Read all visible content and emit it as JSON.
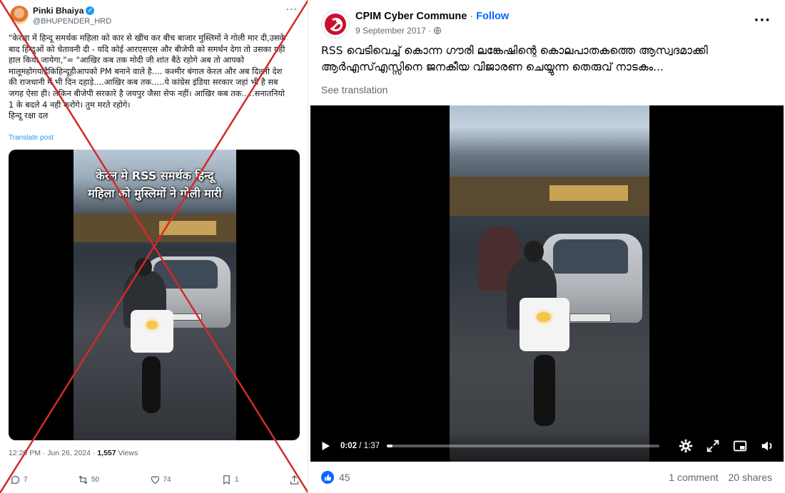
{
  "tweet": {
    "display_name": "Pinki Bhaiya",
    "handle": "@BHUPENDER_HRD",
    "text": "\"केरला में हिन्दू समर्थक महिला को कार से खींच कर बीच बाजार मुस्लिमों ने गोली मार दी,उसके बाद हिन्दुओं को चेतावनी दी - यदि कोई आरएसएस और बीजेपी को समर्थन देगा तो उसका यही हाल किया जायेगा,\"= \"आखिर कब तक मोदी जी शांत बैठे रहोगे अब तो आपको मालूमहोगयाहैकिहिन्दूहीआपको PM बनाने वाले है.... कश्मीर बंगाल केरल और अब दिल्ली देश की राजधानी में भी दिन दहाड़े....आखिर कब तक.....ये कांग्रेस इंडिया सरकार जहां भी है सब जगह ऐसा ही। लेकिन बीजेपी सरकारे है जयपुर जैसा सेफ नहीं। आखिर कब तक.....सनातनियो 1 के बदले 4 नही करोगे। तुम मरते रहोगे।\nहिन्दू रक्षा दल",
    "translate_label": "Translate post",
    "video_caption_line1": "केरल मे RSS समर्थक हिन्दू",
    "video_caption_line2": "महिला को मुस्लिमों ने गोली मारी",
    "timestamp": "12:20 PM · Jun 26, 2024 · ",
    "views_count": "1,557",
    "views_label": " Views",
    "replies": "7",
    "reposts": "50",
    "likes": "74",
    "bookmarks": "1",
    "crossed_out_color": "#d62828"
  },
  "facebook": {
    "page_name": "CPIM Cyber Commune",
    "separator": " · ",
    "follow_label": "Follow",
    "date": "9 September 2017 ·",
    "post_text": "RSS  വെടിവെച്ച് കൊന്ന ഗൗരി ലങ്കേഷിന്റെ കൊലപാതകത്തെ  ആസ്വദമാക്കി ആർഎസ്എസ്സിനെ  ജനകീയ വിജാരണ ചെയ്യുന്ന തെരുവ് നാടകം...",
    "see_translation": "See translation",
    "video_time_current": "0:02",
    "video_time_sep": " / ",
    "video_time_total": "1:37",
    "video_progress": 0.02,
    "like_count": "45",
    "comments": "1 comment",
    "shares": "20 shares",
    "accent_color": "#0866ff"
  }
}
